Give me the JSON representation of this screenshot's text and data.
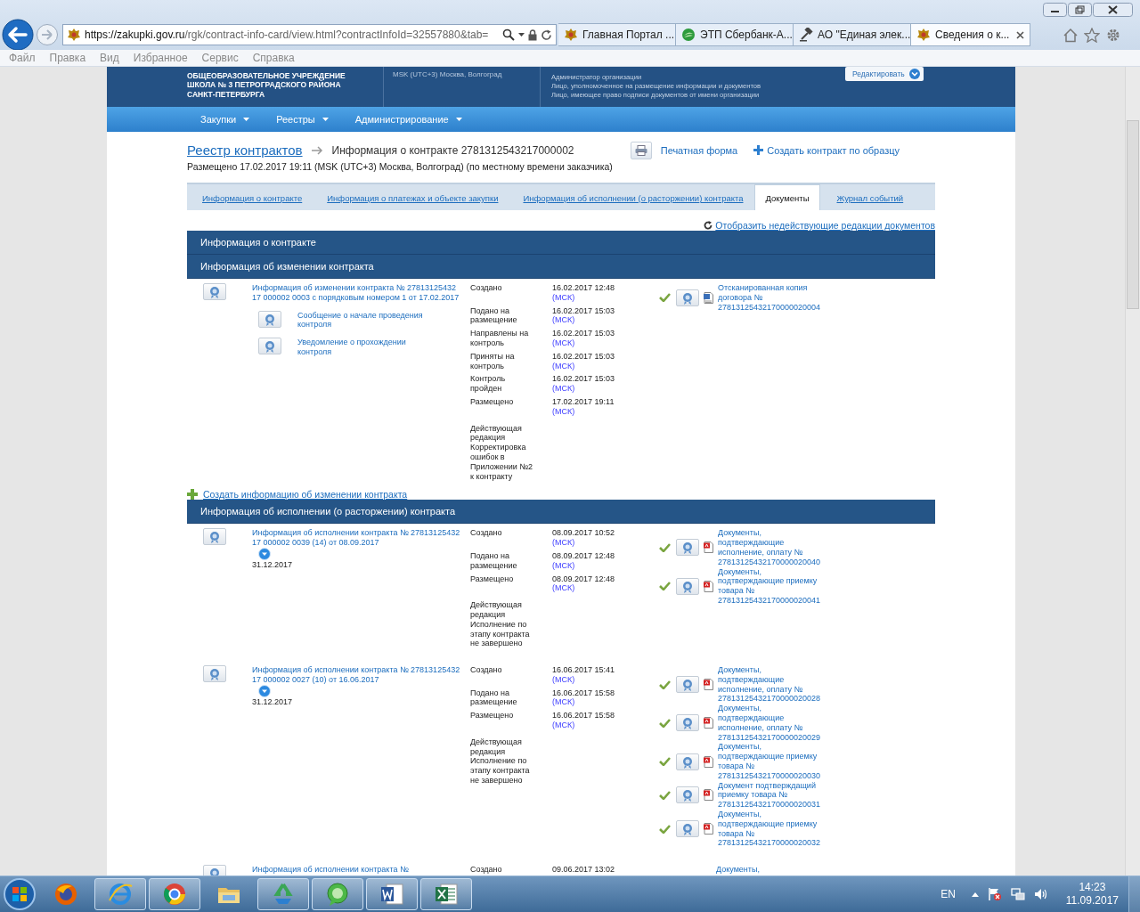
{
  "browser": {
    "address_host": "https://zakupki.gov.ru",
    "address_path": "/rgk/contract-info-card/view.html?contractInfoId=32557880&tab=",
    "tabs": [
      {
        "title": "Главная Портал ...",
        "selected": false
      },
      {
        "title": "ЭТП Сбербанк-А...",
        "selected": false
      },
      {
        "title": "АО \"Единая элек...",
        "selected": false
      },
      {
        "title": "Сведения о к...",
        "selected": true
      }
    ],
    "menu": [
      "Файл",
      "Правка",
      "Вид",
      "Избранное",
      "Сервис",
      "Справка"
    ]
  },
  "header": {
    "org_lines": [
      "ОБЩЕОБРАЗОВАТЕЛЬНОЕ УЧРЕЖДЕНИЕ",
      "ШКОЛА № 3 ПЕТРОГРАДСКОГО РАЙОНА",
      "САНКТ-ПЕТЕРБУРГА"
    ],
    "timezone": "MSK (UTC+3) Москва, Волгоград",
    "user_lines": [
      "Администратор организации",
      "Лицо, уполномоченное на размещение информации и документов",
      "Лицо, имеющее право подписи документов от имени организации"
    ],
    "edit_button": "Редактировать"
  },
  "nav": [
    "Закупки",
    "Реестры",
    "Администрирование"
  ],
  "breadcrumb": {
    "link": "Реестр контрактов",
    "current": "Информация о контракте 2781312543217000002"
  },
  "actions": {
    "print": "Печатная форма",
    "create": "Создать контракт по образцу"
  },
  "placed": "Размещено 17.02.2017 19:11 (MSK (UTC+3) Москва, Волгоград) (по местному времени заказчика)",
  "tabs": [
    {
      "label": "Информация о контракте",
      "selected": false
    },
    {
      "label": "Информация о платежах и объекте закупки",
      "selected": false
    },
    {
      "label": "Информация об исполнении (о расторжении) контракта",
      "selected": false
    },
    {
      "label": "Документы",
      "selected": true
    },
    {
      "label": "Журнал событий",
      "selected": false
    }
  ],
  "show_inactive": "Отобразить недействующие редакции документов",
  "sections": [
    {
      "title": "Информация о контракте"
    },
    {
      "title": "Информация об изменении контракта",
      "add_link": "Создать информацию об изменении контракта",
      "records": [
        {
          "title": "Информация об изменении контракта № 27813125432 17 000002 0003 с порядковым номером 1 от 17.02.2017",
          "subdocs": [
            "Сообщение о начале проведения контроля",
            "Уведомление о прохождении контроля"
          ],
          "events": [
            {
              "label": "Создано",
              "time": "16.02.2017 12:48",
              "zone": "(МСК)"
            },
            {
              "label": "Подано на размещение",
              "time": "16.02.2017 15:03",
              "zone": "(МСК)"
            },
            {
              "label": "Направлены на контроль",
              "time": "16.02.2017 15:03",
              "zone": "(МСК)"
            },
            {
              "label": "Приняты на контроль",
              "time": "16.02.2017 15:03",
              "zone": "(МСК)"
            },
            {
              "label": "Контроль пройден",
              "time": "16.02.2017 15:03",
              "zone": "(МСК)"
            },
            {
              "label": "Размещено",
              "time": "17.02.2017 19:11",
              "zone": "(МСК)"
            }
          ],
          "status": "Действующая редакция Корректировка ошибок в Приложении №2 к контракту",
          "attachments": [
            {
              "name": "Отсканированная копия договора № 27813125432170000020004",
              "kind": "doc",
              "signed": true
            }
          ]
        }
      ]
    },
    {
      "title": "Информация об исполнении (о расторжении) контракта",
      "records": [
        {
          "title": "Информация об исполнении контракта № 27813125432 17 000002 0039 (14) от 08.09.2017",
          "date": "31.12.2017",
          "events": [
            {
              "label": "Создано",
              "time": "08.09.2017 10:52",
              "zone": "(МСК)"
            },
            {
              "label": "Подано на размещение",
              "time": "08.09.2017 12:48",
              "zone": "(МСК)"
            },
            {
              "label": "Размещено",
              "time": "08.09.2017 12:48",
              "zone": "(МСК)"
            }
          ],
          "status": "Действующая редакция Исполнение по этапу контракта не завершено",
          "attachments": [
            {
              "name": "Документы, подтверждающие исполнение, оплату № 27813125432170000020040",
              "kind": "pdf",
              "signed": true
            },
            {
              "name": "Документы, подтверждающие приемку товара № 27813125432170000020041",
              "kind": "pdf",
              "signed": true
            }
          ]
        },
        {
          "title": "Информация об исполнении контракта № 27813125432 17 000002 0027 (10) от 16.06.2017",
          "date": "31.12.2017",
          "events": [
            {
              "label": "Создано",
              "time": "16.06.2017 15:41",
              "zone": "(МСК)"
            },
            {
              "label": "Подано на размещение",
              "time": "16.06.2017 15:58",
              "zone": "(МСК)"
            },
            {
              "label": "Размещено",
              "time": "16.06.2017 15:58",
              "zone": "(МСК)"
            }
          ],
          "status": "Действующая редакция Исполнение по этапу контракта не завершено",
          "attachments": [
            {
              "name": "Документы, подтверждающие исполнение, оплату № 27813125432170000020028",
              "kind": "pdf",
              "signed": true
            },
            {
              "name": "Документы, подтверждающие исполнение, оплату № 27813125432170000020029",
              "kind": "pdf",
              "signed": true
            },
            {
              "name": "Документы, подтверждающие приемку товара № 27813125432170000020030",
              "kind": "pdf",
              "signed": true
            },
            {
              "name": "Документ подтверждащий приемку товара № 27813125432170000020031",
              "kind": "pdf",
              "signed": true
            },
            {
              "name": "Документы, подтверждающие приемку товара № 27813125432170000020032",
              "kind": "pdf",
              "signed": true
            }
          ]
        },
        {
          "title": "Информация об исполнении контракта №",
          "events": [
            {
              "label": "Создано",
              "time": "09.06.2017 13:02"
            }
          ],
          "attachments": [
            {
              "name": "Документы,",
              "signed": false
            }
          ]
        }
      ]
    }
  ],
  "taskbar": {
    "lang": "EN",
    "time": "14:23",
    "date": "11.09.2017"
  }
}
